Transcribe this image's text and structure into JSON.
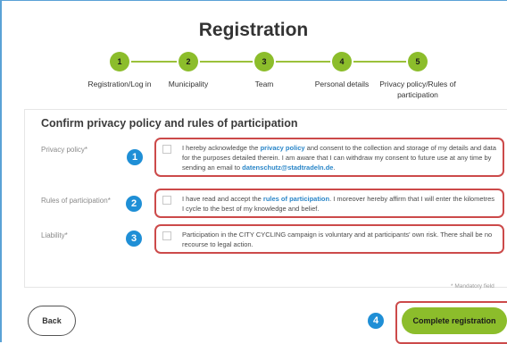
{
  "page": {
    "title": "Registration"
  },
  "steps": [
    {
      "number": "1",
      "label": "Registration/Log in"
    },
    {
      "number": "2",
      "label": "Municipality"
    },
    {
      "number": "3",
      "label": "Team"
    },
    {
      "number": "4",
      "label": "Personal details"
    },
    {
      "number": "5",
      "label": "Privacy policy/Rules of participation"
    }
  ],
  "form": {
    "title": "Confirm privacy policy and rules of participation",
    "fields": [
      {
        "label": "Privacy policy*",
        "badge": "1",
        "checked": false,
        "text_before": "I hereby acknowledge the ",
        "link_text": "privacy policy",
        "text_middle": " and consent to the collection and storage of my details and data for the purposes detailed therein. I am aware that I can withdraw my consent to future use at any time by sending an email to ",
        "email_text": "datenschutz@stadtradeln.de",
        "text_after": "."
      },
      {
        "label": "Rules of participation*",
        "badge": "2",
        "checked": false,
        "text_before": "I have read and accept the ",
        "link_text": "rules of participation",
        "text_after": ". I moreover hereby affirm that I will enter the kilometres I cycle to the best of my knowledge and belief."
      },
      {
        "label": "Liability*",
        "badge": "3",
        "checked": false,
        "text": "Participation in the CITY CYCLING campaign is voluntary and at participants' own risk. There shall be no recourse to legal action."
      }
    ],
    "mandatory_note": "* Mandatory field"
  },
  "footer": {
    "back_label": "Back",
    "complete_badge": "4",
    "complete_label": "Complete registration"
  },
  "colors": {
    "accent_green": "#8cbd2b",
    "badge_blue": "#1f8fd6",
    "highlight_red": "#cc4a4a",
    "link_blue": "#2a86c8"
  }
}
